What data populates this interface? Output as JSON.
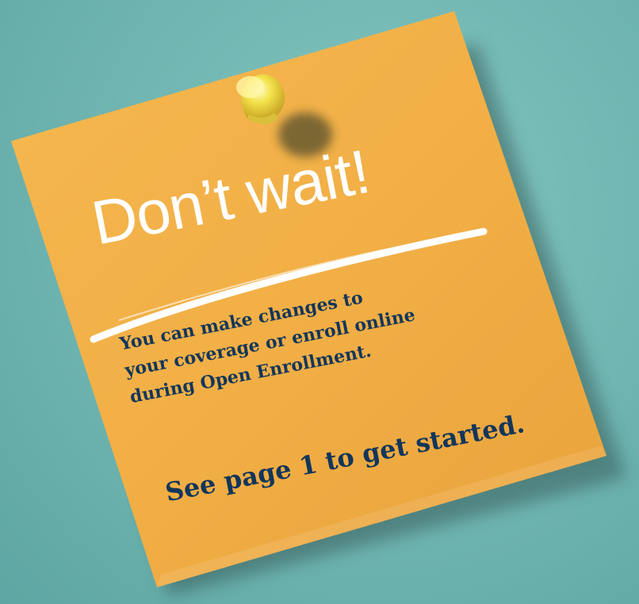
{
  "note": {
    "headline": "Don’t wait!",
    "body_lines": [
      "You can make changes to",
      "your coverage or enroll online",
      "during Open Enrollment."
    ],
    "cta": "See page 1 to get started."
  },
  "colors": {
    "background": "#6fb4b0",
    "note": "#f2b14a",
    "text": "#12365a",
    "headline": "#ffffff",
    "pin": "#f4e24a"
  },
  "icons": {
    "pin": "push-pin-icon"
  }
}
